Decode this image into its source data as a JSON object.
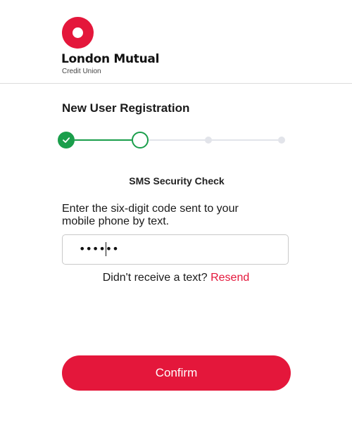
{
  "brand": {
    "name": "London Mutual",
    "subtitle": "Credit Union",
    "accent_color": "#e4173b"
  },
  "page": {
    "title": "New User Registration"
  },
  "stepper": {
    "total_steps": 4,
    "current_step": 2,
    "completed_steps": 1,
    "completed_color": "#1a9e4b",
    "completed_icon": "check-icon"
  },
  "step": {
    "heading": "SMS Security Check",
    "instructions": "Enter the six-digit code sent to your mobile phone by text.",
    "code_mask": "••••••"
  },
  "resend": {
    "prompt": "Didn't receive a text?",
    "link_label": "Resend"
  },
  "actions": {
    "confirm_label": "Confirm"
  }
}
